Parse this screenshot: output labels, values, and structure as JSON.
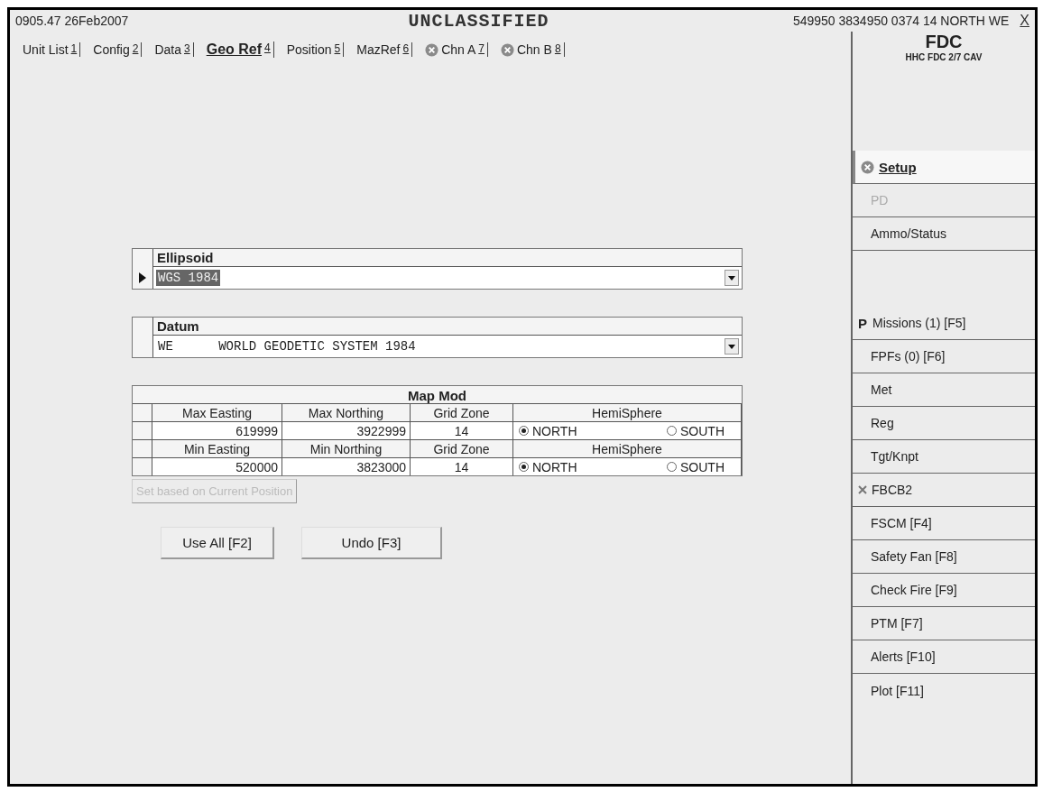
{
  "top_bar": {
    "timestamp": "0905.47 26Feb2007",
    "classification": "UNCLASSIFIED",
    "position": "549950 3834950 0374 14 NORTH WE",
    "close": "X"
  },
  "tabs": [
    {
      "label": "Unit List",
      "key": "1",
      "kind": "plain",
      "selected": false
    },
    {
      "label": "Config",
      "key": "2",
      "kind": "plain",
      "selected": false
    },
    {
      "label": "Data",
      "key": "3",
      "kind": "plain",
      "selected": false
    },
    {
      "label": "Geo Ref",
      "key": "4",
      "kind": "plain",
      "selected": true
    },
    {
      "label": "Position",
      "key": "5",
      "kind": "plain",
      "selected": false
    },
    {
      "label": "MazRef",
      "key": "6",
      "kind": "plain",
      "selected": false
    },
    {
      "label": "Chn A",
      "key": "7",
      "kind": "error",
      "selected": false
    },
    {
      "label": "Chn B",
      "key": "8",
      "kind": "error",
      "selected": false
    }
  ],
  "ellipsoid": {
    "header": "Ellipsoid",
    "value": "WGS 1984",
    "selected": true
  },
  "datum": {
    "header": "Datum",
    "value": "WE      WORLD GEODETIC SYSTEM 1984"
  },
  "map_mod": {
    "title": "Map Mod",
    "rows": [
      {
        "headers": [
          "Max Easting",
          "Max Northing",
          "Grid Zone",
          "HemiSphere"
        ],
        "easting": "619999",
        "northing": "3922999",
        "zone": "14",
        "options": [
          {
            "label": "NORTH",
            "selected": true
          },
          {
            "label": "SOUTH",
            "selected": false
          }
        ]
      },
      {
        "headers": [
          "Min Easting",
          "Min Northing",
          "Grid Zone",
          "HemiSphere"
        ],
        "easting": "520000",
        "northing": "3823000",
        "zone": "14",
        "options": [
          {
            "label": "NORTH",
            "selected": true
          },
          {
            "label": "SOUTH",
            "selected": false
          }
        ]
      }
    ]
  },
  "set_button": {
    "label": "Set based on Current Position",
    "disabled": true
  },
  "buttons": [
    "Use All [F2]",
    "Undo [F3]"
  ],
  "sidebar": {
    "title": "FDC",
    "subtitle": "HHC FDC 2/7 CAV",
    "sections": [
      {
        "items": [
          {
            "label": "Setup",
            "kind": "error",
            "selected": true,
            "disabled": false
          },
          {
            "label": "PD",
            "kind": "plain",
            "selected": false,
            "disabled": true
          },
          {
            "label": "Ammo/Status",
            "kind": "plain",
            "selected": false,
            "disabled": false
          }
        ]
      },
      {
        "items": [
          {
            "label": "Missions (1) [F5]",
            "kind": "prefixed",
            "prefix": "P",
            "selected": false,
            "disabled": false
          },
          {
            "label": "FPFs (0)   [F6]",
            "kind": "plain",
            "selected": false,
            "disabled": false
          },
          {
            "label": "Met",
            "kind": "plain",
            "selected": false,
            "disabled": false
          },
          {
            "label": "Reg",
            "kind": "plain",
            "selected": false,
            "disabled": false
          },
          {
            "label": "Tgt/Knpt",
            "kind": "plain",
            "selected": false,
            "disabled": false
          },
          {
            "label": "FBCB2",
            "kind": "cross",
            "selected": false,
            "disabled": false
          },
          {
            "label": "FSCM [F4]",
            "kind": "plain",
            "selected": false,
            "disabled": false
          },
          {
            "label": "Safety Fan [F8]",
            "kind": "plain",
            "selected": false,
            "disabled": false
          },
          {
            "label": "Check Fire [F9]",
            "kind": "plain",
            "selected": false,
            "disabled": false
          },
          {
            "label": "PTM [F7]",
            "kind": "plain",
            "selected": false,
            "disabled": false
          },
          {
            "label": "Alerts [F10]",
            "kind": "plain",
            "selected": false,
            "disabled": false
          },
          {
            "label": "Plot [F11]",
            "kind": "plain",
            "selected": false,
            "disabled": false
          }
        ]
      }
    ]
  }
}
